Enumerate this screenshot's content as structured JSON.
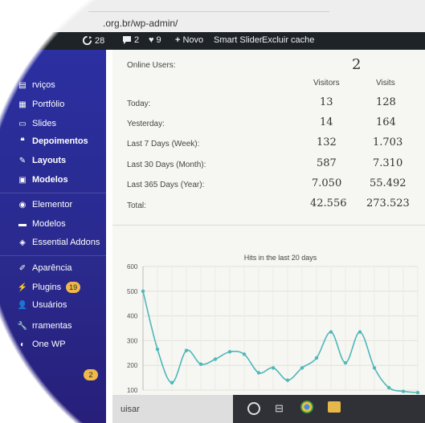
{
  "browser": {
    "url": ".org.br/wp-admin/"
  },
  "adminbar": {
    "updates_count": "28",
    "comments_count": "2",
    "likes_count": "9",
    "new_label": "Novo",
    "smart_slider_label": "Smart Slider",
    "clear_cache_label": "Excluir cache"
  },
  "sidebar": {
    "items": [
      {
        "label": "rviços",
        "icon": "pages-icon"
      },
      {
        "label": "Portfólio",
        "icon": "portfolio-icon"
      },
      {
        "label": "Slides",
        "icon": "slides-icon"
      },
      {
        "label": "Depoimentos",
        "icon": "quote-icon"
      },
      {
        "label": "Layouts",
        "icon": "layouts-icon"
      },
      {
        "label": "Modelos",
        "icon": "templates-icon"
      },
      {
        "label": "Elementor",
        "icon": "elementor-icon"
      },
      {
        "label": "Modelos",
        "icon": "folder-icon"
      },
      {
        "label": "Essential Addons",
        "icon": "addons-icon"
      },
      {
        "label": "Aparência",
        "icon": "brush-icon"
      },
      {
        "label": "Plugins",
        "icon": "plugin-icon",
        "badge": "19"
      },
      {
        "label": "Usuários",
        "icon": "users-icon"
      },
      {
        "label": "rramentas",
        "icon": "tools-icon"
      },
      {
        "label": "One WP",
        "icon": "onewp-icon"
      }
    ],
    "bottom_badge": "2"
  },
  "stats": {
    "online_label": "Online Users:",
    "online_value": "2",
    "col_visitors": "Visitors",
    "col_visits": "Visits",
    "rows": [
      {
        "label": "Today:",
        "visitors": "13",
        "visits": "128"
      },
      {
        "label": "Yesterday:",
        "visitors": "14",
        "visits": "164"
      },
      {
        "label": "Last 7 Days (Week):",
        "visitors": "132",
        "visits": "1.703"
      },
      {
        "label": "Last 30 Days (Month):",
        "visitors": "587",
        "visits": "7.310"
      },
      {
        "label": "Last 365 Days (Year):",
        "visitors": "7.050",
        "visits": "55.492"
      },
      {
        "label": "Total:",
        "visitors": "42.556",
        "visits": "273.523"
      }
    ]
  },
  "chart_data": {
    "type": "line",
    "title": "Hits in the last 20 days",
    "ylim": [
      100,
      600
    ],
    "yticks": [
      600,
      500,
      400,
      300,
      200,
      100
    ],
    "grid": true,
    "series": [
      {
        "color": "#4fb8b8",
        "values": [
          500,
          265,
          130,
          260,
          205,
          225,
          255,
          245,
          170,
          190,
          140,
          190,
          230,
          335,
          210,
          335,
          190,
          110,
          95,
          90
        ]
      }
    ]
  },
  "taskbar": {
    "search_text": "uisar"
  }
}
